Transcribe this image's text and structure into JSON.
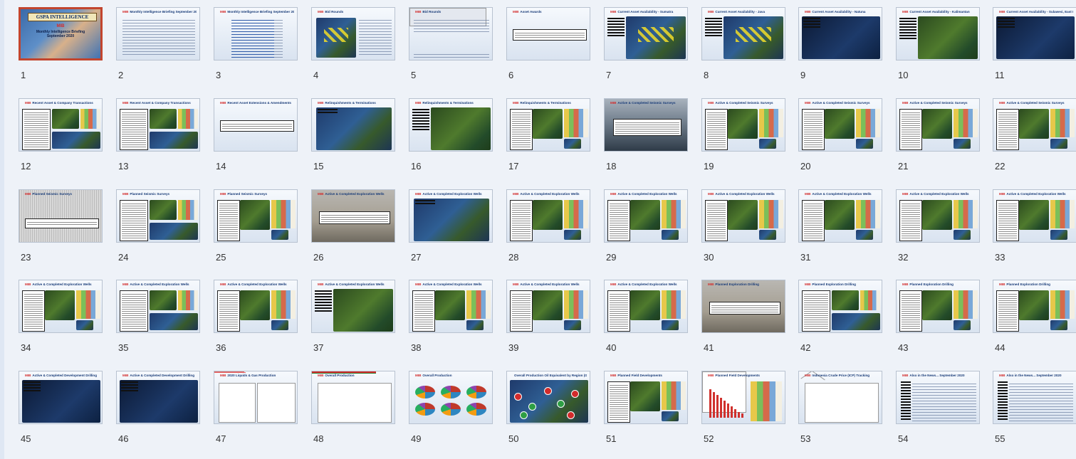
{
  "cover": {
    "banner": "GSPA INTELLIGENCE",
    "mib": "MIB",
    "line1": "Monthly Intelligence Briefing",
    "line2": "September 2020"
  },
  "slides": [
    {
      "num": "1",
      "mib": "",
      "title": "",
      "kind": "cover",
      "selected": true
    },
    {
      "num": "2",
      "mib": "MIB",
      "title": "Monthly Intelligence Briefing September 2020",
      "kind": "text"
    },
    {
      "num": "3",
      "mib": "MIB",
      "title": "Monthly Intelligence Briefing September 2020",
      "kind": "list"
    },
    {
      "num": "4",
      "mib": "MIB",
      "title": "Bid Rounds",
      "kind": "bid"
    },
    {
      "num": "5",
      "mib": "MIB",
      "title": "Bid Rounds",
      "kind": "textmap"
    },
    {
      "num": "6",
      "mib": "MIB",
      "title": "Asset Awards",
      "kind": "box"
    },
    {
      "num": "7",
      "mib": "MIB",
      "title": "Current Asset Availability - Sumatra",
      "kind": "mapY"
    },
    {
      "num": "8",
      "mib": "MIB",
      "title": "Current Asset Availability - Java",
      "kind": "mapY"
    },
    {
      "num": "9",
      "mib": "MIB",
      "title": "Current Asset Availability - Natuna",
      "kind": "mapDark"
    },
    {
      "num": "10",
      "mib": "MIB",
      "title": "Current Asset Availability - Kalimantan",
      "kind": "mapG"
    },
    {
      "num": "11",
      "mib": "MIB",
      "title": "Current Asset Availability - Sulawesi, East Nusa Tenggara, Maluku & Papua",
      "kind": "mapDark"
    },
    {
      "num": "12",
      "mib": "MIB",
      "title": "Recent Asset & Company Transactions",
      "kind": "txn"
    },
    {
      "num": "13",
      "mib": "MIB",
      "title": "Recent Asset & Company Transactions",
      "kind": "txn"
    },
    {
      "num": "14",
      "mib": "MIB",
      "title": "Recent Asset Extensions & Amendments",
      "kind": "box"
    },
    {
      "num": "15",
      "mib": "MIB",
      "title": "Relinquishments & Terminations",
      "kind": "mapOnly"
    },
    {
      "num": "16",
      "mib": "MIB",
      "title": "Relinquishments & Terminations",
      "kind": "mapG"
    },
    {
      "num": "17",
      "mib": "MIB",
      "title": "Relinquishments & Terminations",
      "kind": "seis"
    },
    {
      "num": "18",
      "mib": "MIB",
      "title": "Active & Completed Seismic Surveys",
      "kind": "photoSea"
    },
    {
      "num": "19",
      "mib": "MIB",
      "title": "Active & Completed Seismic Surveys",
      "kind": "seis"
    },
    {
      "num": "20",
      "mib": "MIB",
      "title": "Active & Completed Seismic Surveys",
      "kind": "seis"
    },
    {
      "num": "21",
      "mib": "MIB",
      "title": "Active & Completed Seismic Surveys",
      "kind": "seis"
    },
    {
      "num": "22",
      "mib": "MIB",
      "title": "Active & Completed Seismic Surveys",
      "kind": "seis"
    },
    {
      "num": "23",
      "mib": "MIB",
      "title": "Planned Seismic Surveys",
      "kind": "photoGrey"
    },
    {
      "num": "24",
      "mib": "MIB",
      "title": "Planned Seismic Surveys",
      "kind": "txn"
    },
    {
      "num": "25",
      "mib": "MIB",
      "title": "Planned Seismic Surveys",
      "kind": "seis"
    },
    {
      "num": "26",
      "mib": "MIB",
      "title": "Active & Completed Exploration Wells",
      "kind": "photoRig"
    },
    {
      "num": "27",
      "mib": "MIB",
      "title": "Active & Completed Exploration Wells",
      "kind": "mapOnly"
    },
    {
      "num": "28",
      "mib": "MIB",
      "title": "Active & Completed Exploration Wells",
      "kind": "seis"
    },
    {
      "num": "29",
      "mib": "MIB",
      "title": "Active & Completed Exploration Wells",
      "kind": "seis"
    },
    {
      "num": "30",
      "mib": "MIB",
      "title": "Active & Completed Exploration Wells",
      "kind": "seis"
    },
    {
      "num": "31",
      "mib": "MIB",
      "title": "Active & Completed Exploration Wells",
      "kind": "seis"
    },
    {
      "num": "32",
      "mib": "MIB",
      "title": "Active & Completed Exploration Wells",
      "kind": "seis"
    },
    {
      "num": "33",
      "mib": "MIB",
      "title": "Active & Completed Exploration Wells",
      "kind": "seis"
    },
    {
      "num": "34",
      "mib": "MIB",
      "title": "Active & Completed Exploration Wells",
      "kind": "seis"
    },
    {
      "num": "35",
      "mib": "MIB",
      "title": "Active & Completed Exploration Wells",
      "kind": "txn"
    },
    {
      "num": "36",
      "mib": "MIB",
      "title": "Active & Completed Exploration Wells",
      "kind": "seis"
    },
    {
      "num": "37",
      "mib": "MIB",
      "title": "Active & Completed Exploration Wells",
      "kind": "mapG"
    },
    {
      "num": "38",
      "mib": "MIB",
      "title": "Active & Completed Exploration Wells",
      "kind": "seis"
    },
    {
      "num": "39",
      "mib": "MIB",
      "title": "Active & Completed Exploration Wells",
      "kind": "seis"
    },
    {
      "num": "40",
      "mib": "MIB",
      "title": "Active & Completed Exploration Wells",
      "kind": "seis"
    },
    {
      "num": "41",
      "mib": "MIB",
      "title": "Planned Exploration Drilling",
      "kind": "photoRig"
    },
    {
      "num": "42",
      "mib": "MIB",
      "title": "Planned Exploration Drilling",
      "kind": "txn"
    },
    {
      "num": "43",
      "mib": "MIB",
      "title": "Planned Exploration Drilling",
      "kind": "seis"
    },
    {
      "num": "44",
      "mib": "MIB",
      "title": "Planned Exploration Drilling",
      "kind": "seis"
    },
    {
      "num": "45",
      "mib": "MIB",
      "title": "Active & Completed Development Drilling",
      "kind": "mapDark"
    },
    {
      "num": "46",
      "mib": "MIB",
      "title": "Active & Completed Development Drilling",
      "kind": "mapDark"
    },
    {
      "num": "47",
      "mib": "MIB",
      "title": "2020 Liquids & Gas Production",
      "kind": "lines"
    },
    {
      "num": "48",
      "mib": "MIB",
      "title": "Overall Production",
      "kind": "lineRed"
    },
    {
      "num": "49",
      "mib": "MIB",
      "title": "Overall Production",
      "kind": "pies"
    },
    {
      "num": "50",
      "mib": "",
      "title": "Overall Production Oil Equivalent by Region (Gold & Mbbls)",
      "kind": "mapPies"
    },
    {
      "num": "51",
      "mib": "MIB",
      "title": "Planned Field Developments",
      "kind": "seis"
    },
    {
      "num": "52",
      "mib": "MIB",
      "title": "Planned Field Developments",
      "kind": "bars"
    },
    {
      "num": "53",
      "mib": "MIB",
      "title": "Indonesia Crude Price (ICP) Tracking",
      "kind": "icp"
    },
    {
      "num": "54",
      "mib": "MIB",
      "title": "Also in the News... September 2020",
      "kind": "news"
    },
    {
      "num": "55",
      "mib": "MIB",
      "title": "Also in the News... September 2020",
      "kind": "news"
    }
  ]
}
